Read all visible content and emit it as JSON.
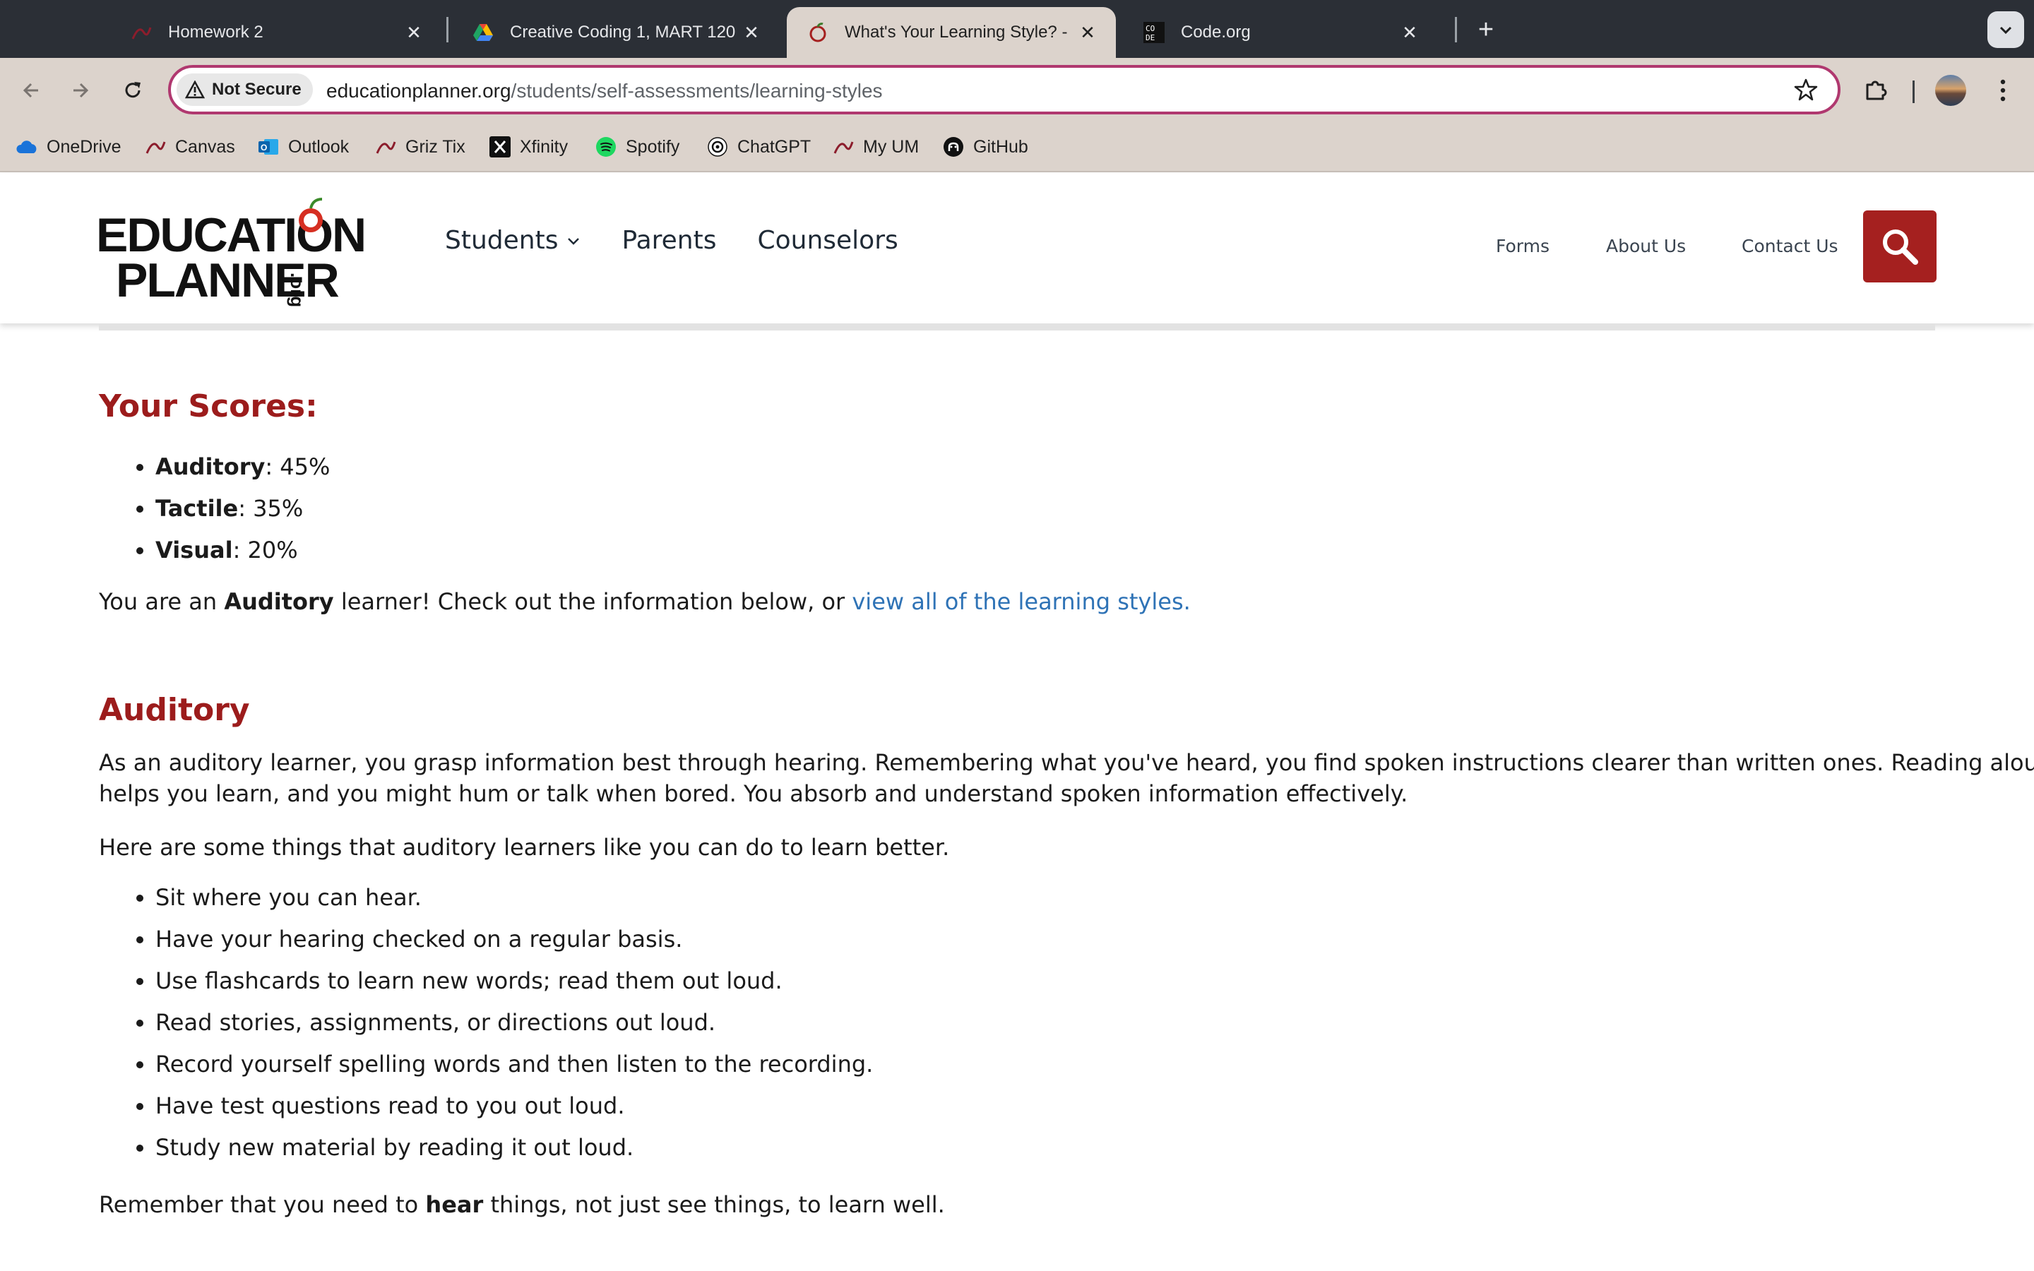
{
  "browser": {
    "tabs": [
      {
        "title": "Homework 2",
        "icon": "canvas-logo"
      },
      {
        "title": "Creative Coding 1, MART 120",
        "icon": "google-drive-logo"
      },
      {
        "title": "What's Your Learning Style? -",
        "icon": "apple-logo",
        "active": true
      },
      {
        "title": "Code.org",
        "icon": "code-org-logo"
      }
    ],
    "security_label": "Not Secure",
    "url_domain": "educationplanner.org",
    "url_path": "/students/self-assessments/learning-styles",
    "bookmarks": [
      {
        "label": "OneDrive",
        "icon": "onedrive-cloud"
      },
      {
        "label": "Canvas",
        "icon": "canvas-logo"
      },
      {
        "label": "Outlook",
        "icon": "outlook-logo"
      },
      {
        "label": "Griz Tix",
        "icon": "canvas-logo"
      },
      {
        "label": "Xfinity",
        "icon": "x-logo"
      },
      {
        "label": "Spotify",
        "icon": "spotify-logo"
      },
      {
        "label": "ChatGPT",
        "icon": "chatgpt-logo"
      },
      {
        "label": "My UM",
        "icon": "canvas-logo"
      },
      {
        "label": "GitHub",
        "icon": "github-logo"
      }
    ]
  },
  "site": {
    "logo_line1": "EDUCATION",
    "logo_line2": "PLANNER",
    "logo_suffix": ".org",
    "nav": {
      "students": "Students",
      "parents": "Parents",
      "counselors": "Counselors"
    },
    "util_nav": {
      "forms": "Forms",
      "about": "About Us",
      "contact": "Contact Us"
    },
    "brand_red": "#a5201f"
  },
  "results": {
    "heading": "Your Scores:",
    "scores": [
      {
        "style": "Auditory",
        "value": ": 45%"
      },
      {
        "style": "Tactile",
        "value": ": 35%"
      },
      {
        "style": "Visual",
        "value": ": 20%"
      }
    ],
    "summary_prefix": "You are an ",
    "summary_style": "Auditory",
    "summary_suffix": " learner! Check out the information below, or ",
    "summary_link": "view all of the learning styles."
  },
  "auditory": {
    "heading": "Auditory",
    "description_line1": "As an auditory learner, you grasp information best through hearing. Remembering what you've heard, you find spoken instructions clearer than written ones. Reading aloud",
    "description_line2": "helps you learn, and you might hum or talk when bored. You absorb and understand spoken information effectively.",
    "intro": "Here are some things that auditory learners like you can do to learn better.",
    "tips": [
      "Sit where you can hear.",
      "Have your hearing checked on a regular basis.",
      "Use flashcards to learn new words; read them out loud.",
      "Read stories, assignments, or directions out loud.",
      "Record yourself spelling words and then listen to the recording.",
      "Have test questions read to you out loud.",
      "Study new material by reading it out loud."
    ],
    "closing_prefix": "Remember that you need to ",
    "closing_bold": "hear",
    "closing_suffix": " things, not just see things, to learn well."
  }
}
